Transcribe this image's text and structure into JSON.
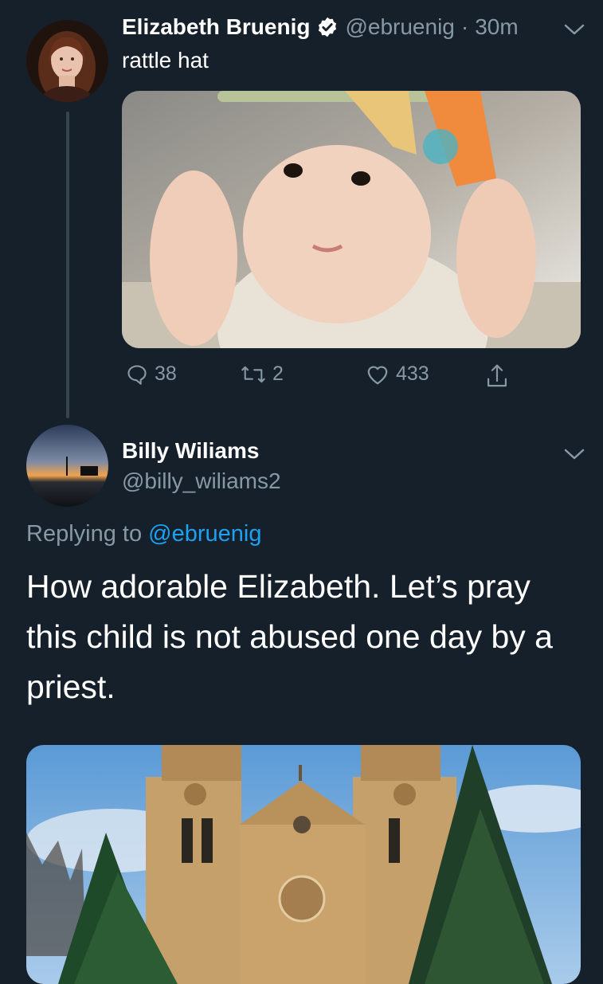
{
  "tweet": {
    "author_name": "Elizabeth Bruenig",
    "handle": "@ebruenig",
    "separator": "·",
    "time": "30m",
    "text": "rattle hat",
    "stats": {
      "replies": "38",
      "retweets": "2",
      "likes": "433"
    },
    "icons": {
      "verified": "verified-badge-icon",
      "menu": "chevron-down-icon",
      "reply": "speech-bubble-icon",
      "retweet": "retweet-icon",
      "like": "heart-icon",
      "share": "share-icon"
    },
    "media_alt": "baby with rattle on head"
  },
  "reply": {
    "author_name": "Billy Wiliams",
    "handle": "@billy_wiliams2",
    "replying_prefix": "Replying to",
    "replying_handle": "@ebruenig",
    "text": "How adorable Elizabeth. Let’s pray this child is not abused one day by a priest.",
    "media_alt": "cathedral with two towers and evergreen trees"
  },
  "colors": {
    "background": "#15202b",
    "text_primary": "#ffffff",
    "text_muted": "#8899a6",
    "accent_blue": "#1da1f2",
    "thread_line": "#38444d"
  }
}
